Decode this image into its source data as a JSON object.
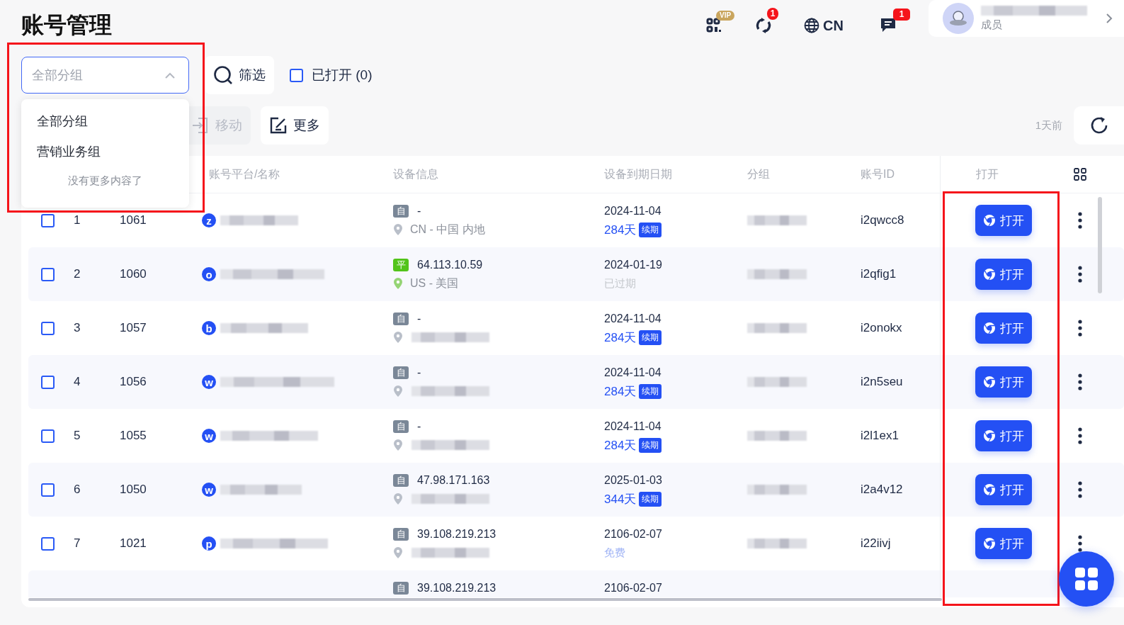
{
  "title": "账号管理",
  "header": {
    "vip_badge": "VIP",
    "sync_badge": "1",
    "language": "CN",
    "message_badge": "1",
    "user_role": "成员"
  },
  "toolbar": {
    "group_select": {
      "placeholder": "全部分组",
      "expanded": true
    },
    "filter": "筛选",
    "opened_filter": {
      "label": "已打开 (0)",
      "checked": false
    },
    "move": {
      "label": "移动",
      "disabled": true
    },
    "more": "更多",
    "updated": "1天前"
  },
  "group_menu": {
    "items": [
      "全部分组",
      "营销业务组"
    ],
    "footer": "没有更多内容了"
  },
  "table": {
    "columns": [
      "账号平台/名称",
      "设备信息",
      "设备到期日期",
      "分组",
      "账号ID",
      "打开"
    ],
    "rows": [
      {
        "checked": false,
        "index": "1",
        "id": "1061",
        "platform": "z",
        "device_tag": {
          "kind": "self",
          "label": "自"
        },
        "ip": "-",
        "location": "CN - 中国 内地",
        "expiry": "2024-11-04",
        "status": {
          "kind": "active",
          "days": "284天",
          "action": "续期"
        },
        "account_id": "i2qwcc8",
        "open": "打开"
      },
      {
        "checked": false,
        "index": "2",
        "id": "1060",
        "platform": "o",
        "device_tag": {
          "kind": "platform",
          "label": "平"
        },
        "ip": "64.113.10.59",
        "location": "US - 美国",
        "expiry": "2024-01-19",
        "status": {
          "kind": "expired",
          "text": "已过期"
        },
        "account_id": "i2qfig1",
        "open": "打开"
      },
      {
        "checked": false,
        "index": "3",
        "id": "1057",
        "platform": "b",
        "device_tag": {
          "kind": "self",
          "label": "自"
        },
        "ip": "-",
        "expiry": "2024-11-04",
        "status": {
          "kind": "active",
          "days": "284天",
          "action": "续期"
        },
        "account_id": "i2onokx",
        "open": "打开"
      },
      {
        "checked": false,
        "index": "4",
        "id": "1056",
        "platform": "w",
        "device_tag": {
          "kind": "self",
          "label": "自"
        },
        "ip": "-",
        "expiry": "2024-11-04",
        "status": {
          "kind": "active",
          "days": "284天",
          "action": "续期"
        },
        "account_id": "i2n5seu",
        "open": "打开"
      },
      {
        "checked": false,
        "index": "5",
        "id": "1055",
        "platform": "w",
        "device_tag": {
          "kind": "self",
          "label": "自"
        },
        "ip": "-",
        "expiry": "2024-11-04",
        "status": {
          "kind": "active",
          "days": "284天",
          "action": "续期"
        },
        "account_id": "i2l1ex1",
        "open": "打开"
      },
      {
        "checked": false,
        "index": "6",
        "id": "1050",
        "platform": "w",
        "device_tag": {
          "kind": "self",
          "label": "自"
        },
        "ip": "47.98.171.163",
        "expiry": "2025-01-03",
        "status": {
          "kind": "active",
          "days": "344天",
          "action": "续期"
        },
        "account_id": "i2a4v12",
        "open": "打开"
      },
      {
        "checked": false,
        "index": "7",
        "id": "1021",
        "platform": "p",
        "device_tag": {
          "kind": "self",
          "label": "自"
        },
        "ip": "39.108.219.213",
        "expiry": "2106-02-07",
        "status": {
          "kind": "free",
          "text": "免费"
        },
        "account_id": "i22iivj",
        "open": "打开"
      },
      {
        "device_tag": {
          "kind": "self",
          "label": "自"
        },
        "ip": "39.108.219.213",
        "expiry": "2106-02-07"
      }
    ]
  }
}
